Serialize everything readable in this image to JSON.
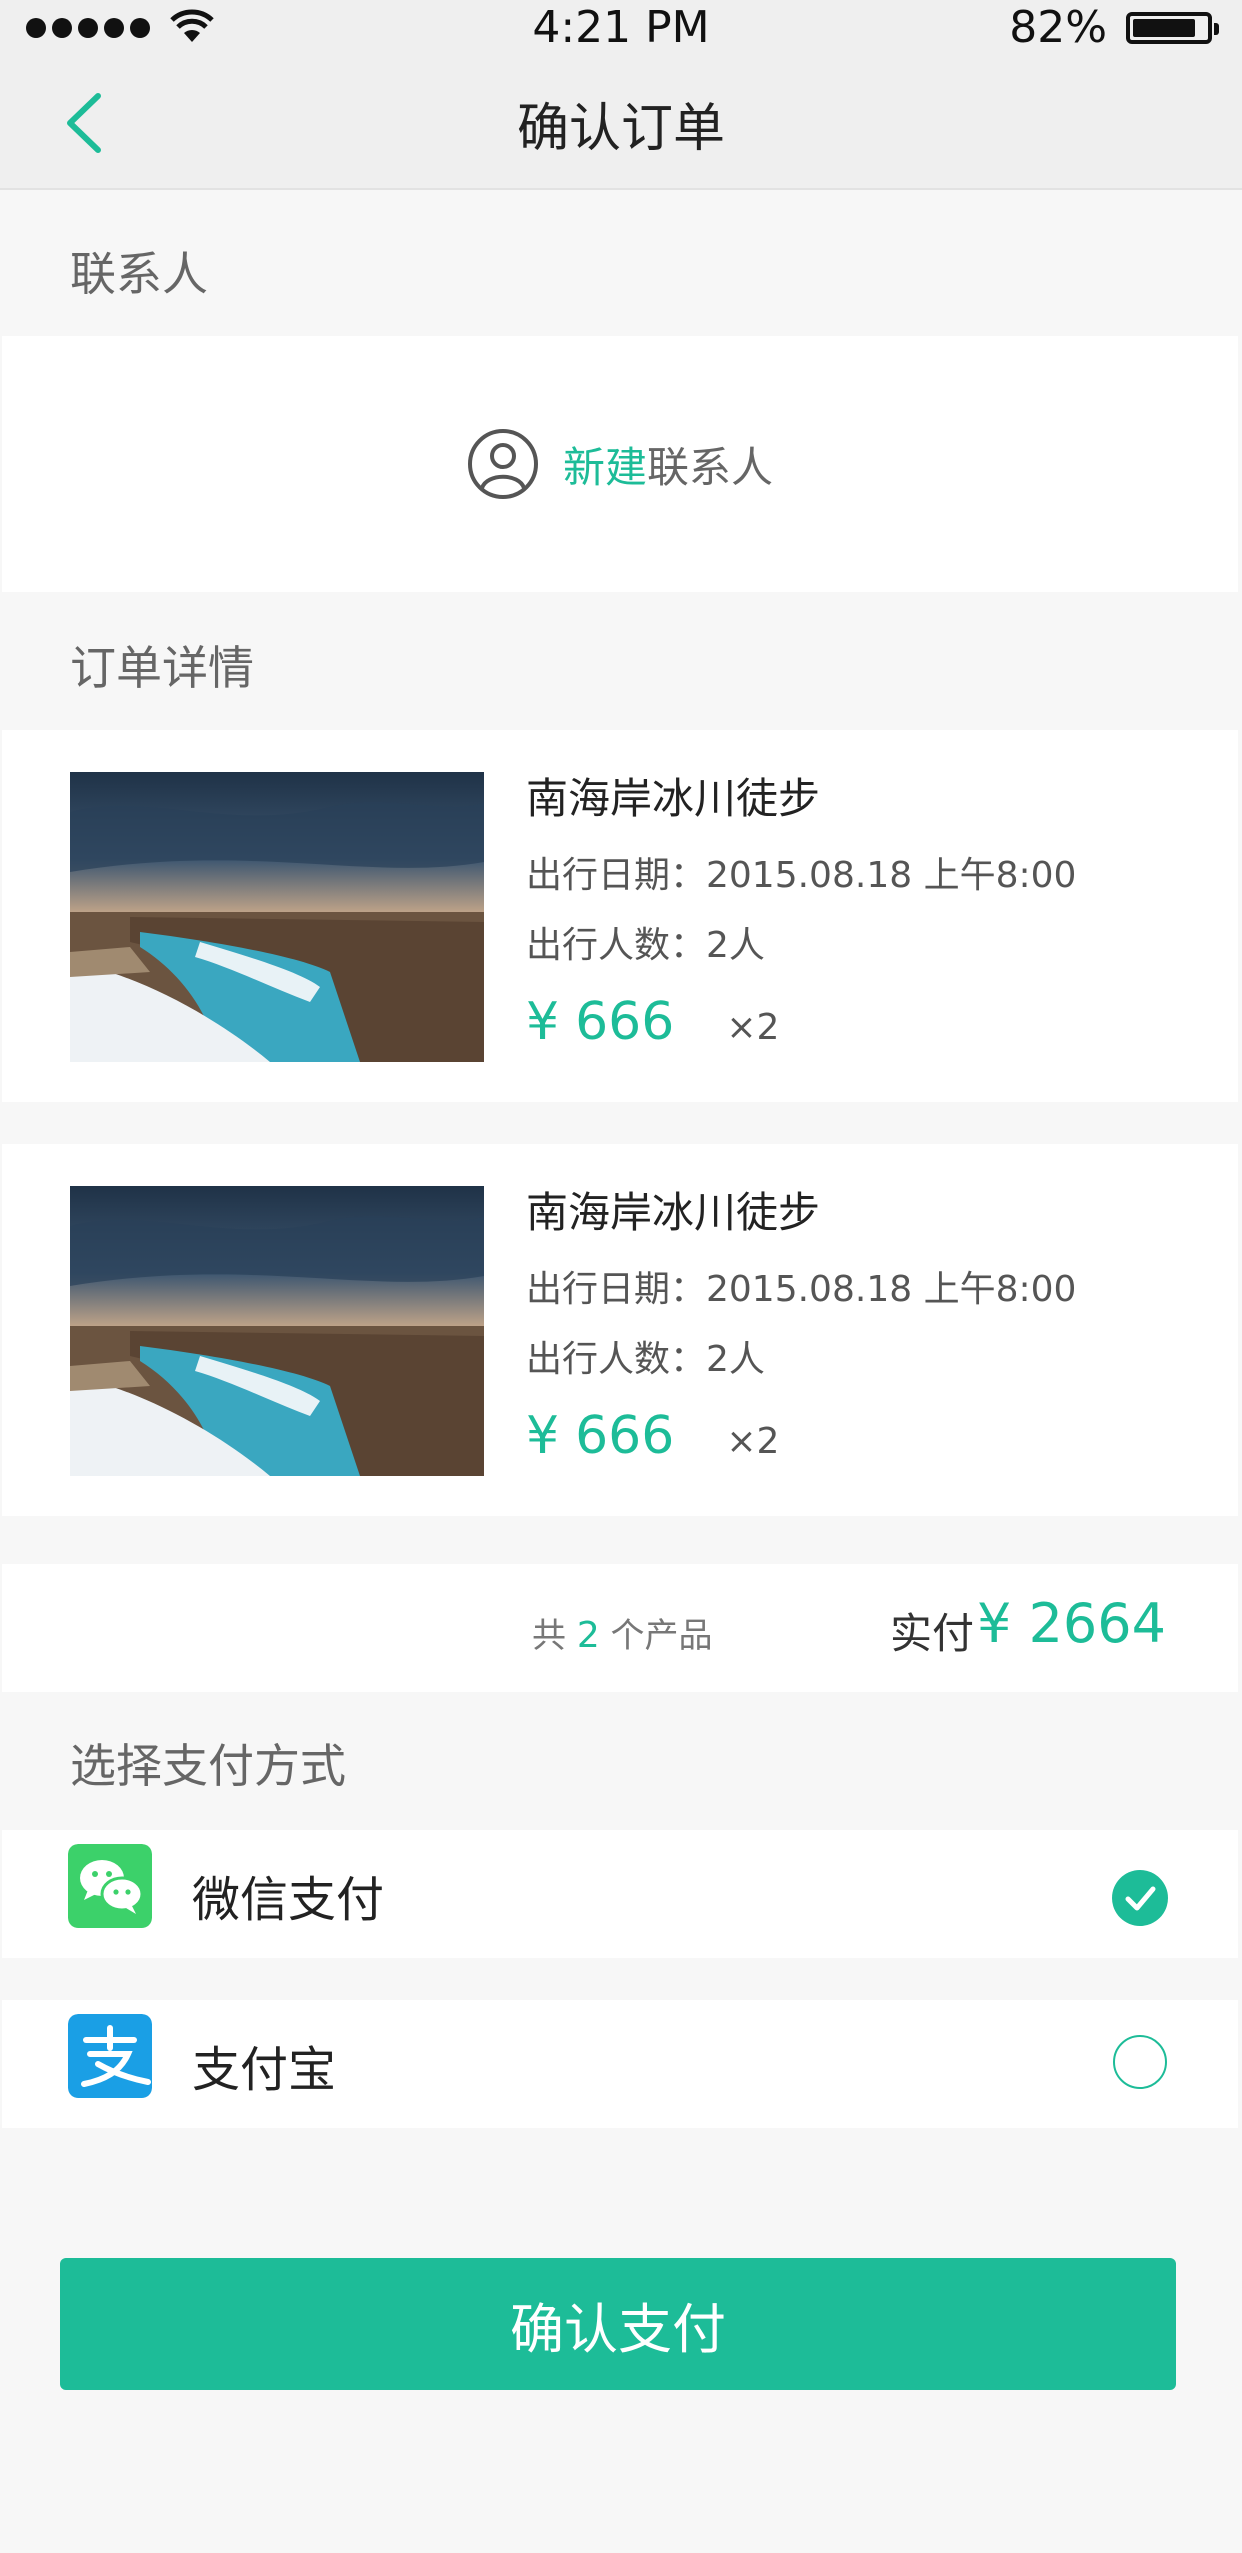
{
  "status_bar": {
    "time": "4:21 PM",
    "battery": "82%"
  },
  "nav": {
    "title": "确认订单"
  },
  "contact": {
    "section_label": "联系人",
    "new_label": "新建",
    "contact_label": "联系人"
  },
  "order": {
    "section_label": "订单详情",
    "items": [
      {
        "title": "南海岸冰川徒步",
        "date": "出行日期：2015.08.18  上午8:00",
        "people": "出行人数：2人",
        "currency": "¥",
        "price": "666",
        "qty": "×2"
      },
      {
        "title": "南海岸冰川徒步",
        "date": "出行日期：2015.08.18  上午8:00",
        "people": "出行人数：2人",
        "currency": "¥",
        "price": "666",
        "qty": "×2"
      }
    ]
  },
  "summary": {
    "count_prefix": "共",
    "count": "2",
    "count_suffix": "个产品",
    "paid_label": "实付",
    "currency": "¥",
    "total": "2664"
  },
  "payment": {
    "section_label": "选择支付方式",
    "options": [
      {
        "label": "微信支付",
        "icon": "wechat-pay-icon",
        "selected": true
      },
      {
        "label": "支付宝",
        "icon": "alipay-icon",
        "selected": false
      }
    ]
  },
  "confirm_button": "确认支付",
  "colors": {
    "accent": "#1dbc98",
    "wechat": "#3cd16a",
    "alipay": "#1a9fe5"
  }
}
